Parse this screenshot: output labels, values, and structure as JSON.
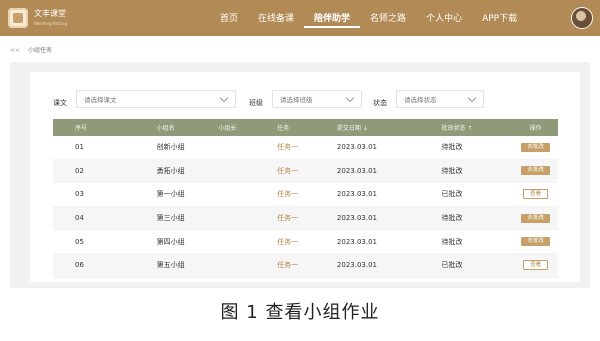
{
  "header": {
    "brand": "文丰课堂",
    "brand_sub": "Wenfeng Ketang",
    "nav": [
      "首页",
      "在线备课",
      "陪伴助学",
      "名师之路",
      "个人中心",
      "APP下载"
    ],
    "active_nav": "陪伴助学"
  },
  "breadcrumb": {
    "back": "<<",
    "label": "小组任务"
  },
  "filters": [
    {
      "label": "课文",
      "placeholder": "请选择课文"
    },
    {
      "label": "班级",
      "placeholder": "请选择班级"
    },
    {
      "label": "状态",
      "placeholder": "请选择状态"
    }
  ],
  "table": {
    "headers": [
      "序号",
      "小组名",
      "小组长",
      "任务",
      "提交日期 ↓",
      "批改状态 ↑",
      "操作"
    ],
    "rows": [
      {
        "no": "01",
        "group": "创新小组",
        "leader": "",
        "task": "任务一",
        "date": "2023.03.01",
        "status": "待批改",
        "action": "去批改"
      },
      {
        "no": "02",
        "group": "勇拓小组",
        "leader": "",
        "task": "任务一",
        "date": "2023.03.01",
        "status": "待批改",
        "action": "去批改"
      },
      {
        "no": "03",
        "group": "第一小组",
        "leader": "",
        "task": "任务一",
        "date": "2023.03.01",
        "status": "已批改",
        "action": "查看"
      },
      {
        "no": "04",
        "group": "第三小组",
        "leader": "",
        "task": "任务一",
        "date": "2023.03.01",
        "status": "待批改",
        "action": "去批改"
      },
      {
        "no": "05",
        "group": "第四小组",
        "leader": "",
        "task": "任务一",
        "date": "2023.03.01",
        "status": "待批改",
        "action": "去批改"
      },
      {
        "no": "06",
        "group": "第五小组",
        "leader": "",
        "task": "任务一",
        "date": "2023.03.01",
        "status": "已批改",
        "action": "查看"
      }
    ]
  },
  "caption": "图 1   查看小组作业",
  "colors": {
    "brand": "#b28a56",
    "table_header": "#8e9a78",
    "action": "#c79f68"
  }
}
